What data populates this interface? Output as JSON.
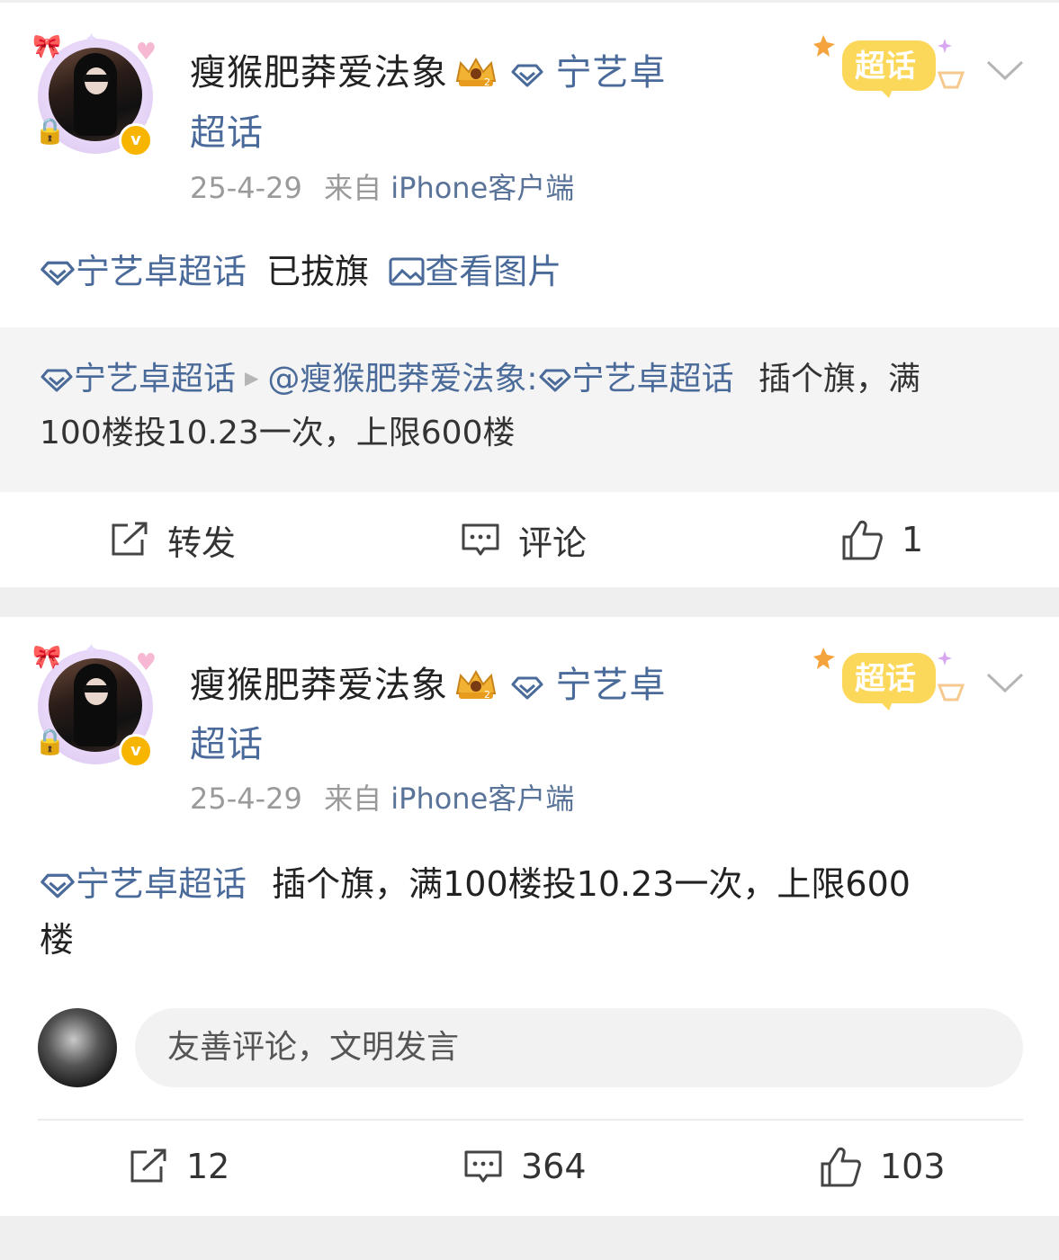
{
  "posts": [
    {
      "username": "瘦猴肥莽爱法象",
      "topic": "宁艺卓",
      "topic_cont": "超话",
      "date": "25-4-29",
      "source_prefix": "来自",
      "source": "iPhone客户端",
      "badge": "超话",
      "body": {
        "topic": "宁艺卓超话",
        "text": "已拔旗",
        "pic_label": "查看图片"
      },
      "quote": {
        "topic": "宁艺卓超话",
        "mention": "@瘦猴肥莽爱法象:",
        "topic2": "宁艺卓超话",
        "text1": "插个旗，满",
        "text2": "100楼投10.23一次，上限600楼"
      },
      "actions": {
        "repost": "转发",
        "comment": "评论",
        "like": "1"
      }
    },
    {
      "username": "瘦猴肥莽爱法象",
      "topic": "宁艺卓",
      "topic_cont": "超话",
      "date": "25-4-29",
      "source_prefix": "来自",
      "source": "iPhone客户端",
      "badge": "超话",
      "body": {
        "topic": "宁艺卓超话",
        "text1": "插个旗，满100楼投10.23一次，上限600",
        "text2": "楼"
      },
      "comment_placeholder": "友善评论，文明发言",
      "actions": {
        "repost": "12",
        "comment": "364",
        "like": "103"
      }
    }
  ],
  "colors": {
    "link": "#4a6a9a",
    "verified_badge": "#f7b500",
    "meta_gray": "#9a9a9a",
    "quote_bg": "#f4f4f4"
  },
  "icons": [
    "diamond-icon",
    "crown-icon",
    "chaohua-badge-icon",
    "chevron-down-icon",
    "image-icon",
    "repost-icon",
    "comment-icon",
    "like-icon",
    "verified-icon"
  ]
}
